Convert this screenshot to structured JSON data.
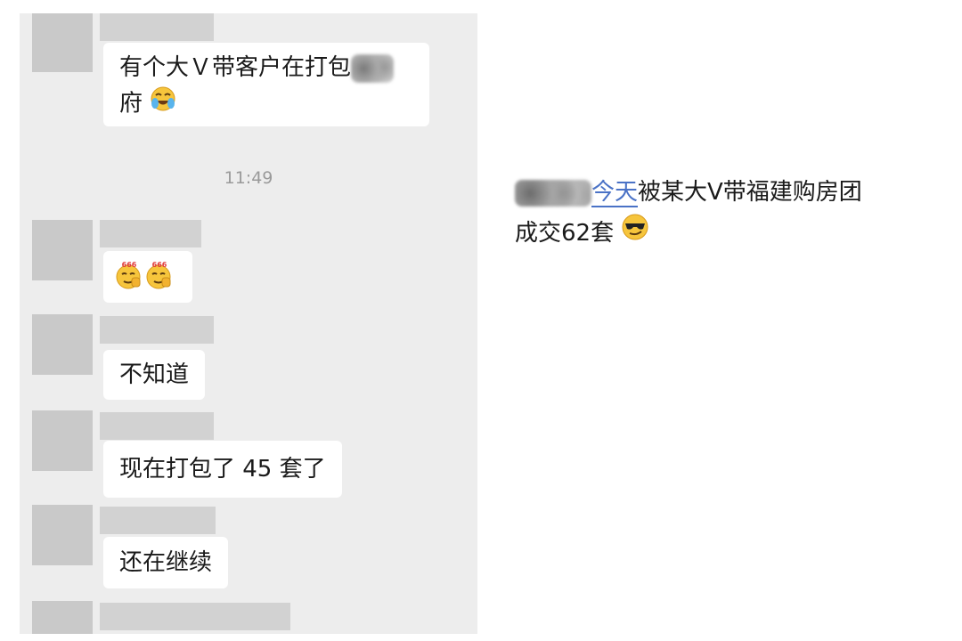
{
  "chat": {
    "messages": [
      {
        "line1": "有个大Ｖ带客户在打包",
        "line2": "府"
      },
      {
        "emoji_tag": "666"
      },
      {
        "text": "不知道"
      },
      {
        "text": "现在打包了 45 套了"
      },
      {
        "text": "还在继续"
      }
    ],
    "timestamp": "11:49"
  },
  "post": {
    "line1_link": "今天",
    "line1_rest": "被某大V带福建购房团",
    "line2": "成交62套"
  },
  "icons": {
    "crying_laughing": "crying-laughing-emoji",
    "thumbs_up_666": "666-thumbs-up-emoji",
    "sunglasses": "sunglasses-emoji"
  },
  "colors": {
    "chat_background": "#ededed",
    "bubble": "#ffffff",
    "avatar_placeholder": "#c9c9c9",
    "link": "#4a72c6"
  }
}
